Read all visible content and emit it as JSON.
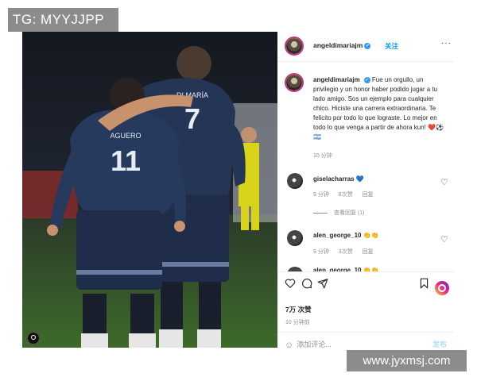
{
  "watermark_top": "TG: MYYJJPP",
  "watermark_bottom": "www.jyxmsj.com",
  "post": {
    "jerseys": {
      "left_name": "AGUERO",
      "left_number": "11",
      "right_name": "DI MARÍA",
      "right_number": "7"
    },
    "header": {
      "username": "angeldimariajm",
      "follow_label": "关注",
      "more_icon": "more-icon"
    },
    "caption": {
      "username": "angeldimariajm",
      "text": "Fue un orgullo, un privilegio y un honor haber podido jugar a tu lado amigo. Sos un ejemplo para cualquier chico. Hiciste una carrera extraordinaria. Te felicito por todo lo que lograste. Lo mejor en todo lo que venga a partir de ahora kun! ❤️⚽🇦🇷",
      "time": "10 分钟"
    },
    "comments": [
      {
        "username": "giselacharras",
        "text": "💙",
        "time": "9 分钟",
        "likes": "8次赞",
        "reply": "回复"
      },
      {
        "username": "alen_george_10",
        "text": "👏👏",
        "time": "9 分钟",
        "likes": "3次赞",
        "reply": "回复"
      },
      {
        "username": "alen_george_10",
        "text": "👏👏"
      }
    ],
    "view_replies": "查看回复 (1)",
    "likes": "7万 次赞",
    "time_ago": "10 分钟前",
    "comment_placeholder": "添加评论...",
    "post_button": "发布"
  },
  "colors": {
    "link_blue": "#0095f6",
    "story_ring": "#c13584",
    "watermark_bg": "#8c8c8c"
  }
}
